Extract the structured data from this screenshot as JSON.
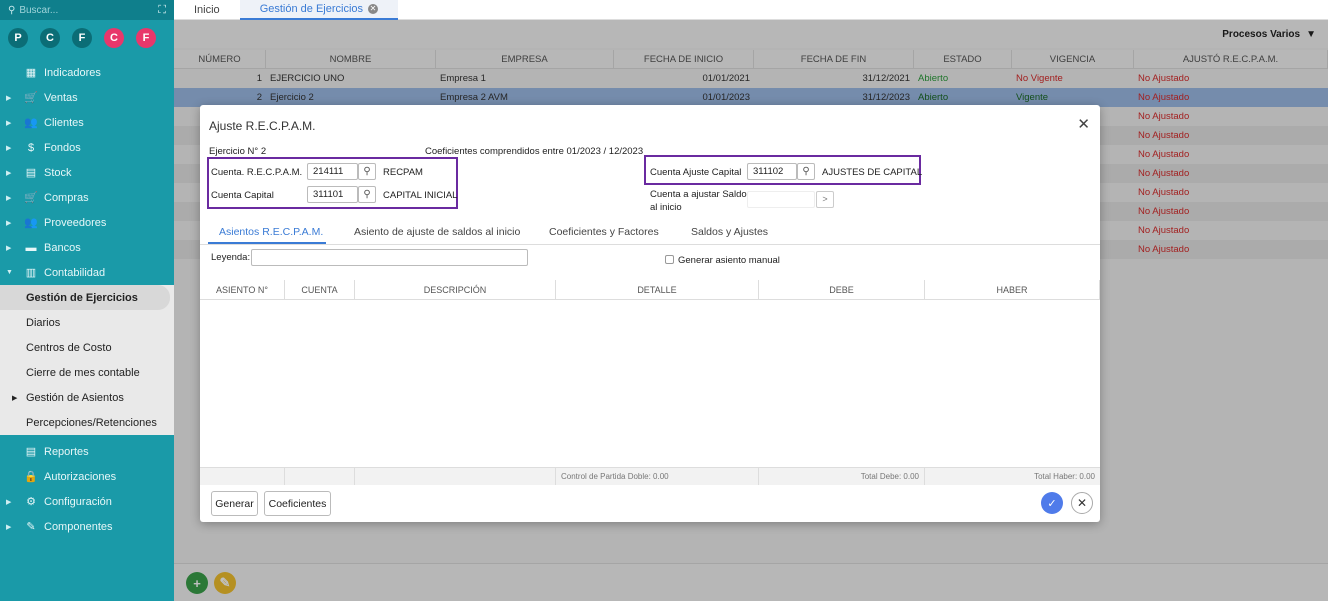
{
  "sidebar": {
    "search_placeholder": "Buscar...",
    "circles": [
      "P",
      "C",
      "F",
      "C",
      "F"
    ],
    "items": [
      {
        "label": "Indicadores",
        "icon": "grid-icon",
        "glyph": "▦",
        "arrow": ""
      },
      {
        "label": "Ventas",
        "icon": "cart-icon",
        "glyph": "🛒",
        "arrow": "▶"
      },
      {
        "label": "Clientes",
        "icon": "people-icon",
        "glyph": "👥",
        "arrow": "▶"
      },
      {
        "label": "Fondos",
        "icon": "dollar-icon",
        "glyph": "$",
        "arrow": "▶"
      },
      {
        "label": "Stock",
        "icon": "box-icon",
        "glyph": "▤",
        "arrow": "▶"
      },
      {
        "label": "Compras",
        "icon": "cart-icon",
        "glyph": "🛒",
        "arrow": "▶"
      },
      {
        "label": "Proveedores",
        "icon": "people-icon",
        "glyph": "👥",
        "arrow": "▶"
      },
      {
        "label": "Bancos",
        "icon": "bank-icon",
        "glyph": "▬",
        "arrow": "▶"
      },
      {
        "label": "Contabilidad",
        "icon": "book-icon",
        "glyph": "▥",
        "arrow": "▼"
      }
    ],
    "sub_items": [
      {
        "label": "Gestión de Ejercicios",
        "active": true
      },
      {
        "label": "Diarios"
      },
      {
        "label": "Centros de Costo"
      },
      {
        "label": "Cierre de mes contable"
      },
      {
        "label": "Gestión de Asientos",
        "arrow": "▶"
      },
      {
        "label": "Percepciones/Retenciones"
      }
    ],
    "items_after": [
      {
        "label": "Reportes",
        "icon": "report-icon",
        "glyph": "▤",
        "arrow": ""
      },
      {
        "label": "Autorizaciones",
        "icon": "lock-icon",
        "glyph": "🔒",
        "arrow": ""
      },
      {
        "label": "Configuración",
        "icon": "gear-icon",
        "glyph": "⚙",
        "arrow": "▶"
      },
      {
        "label": "Componentes",
        "icon": "puzzle-icon",
        "glyph": "✎",
        "arrow": "▶"
      }
    ]
  },
  "topbar": {
    "tab_home": "Inicio",
    "tab_active": "Gestión de Ejercicios"
  },
  "procesos": "Procesos Varios",
  "table": {
    "headers": [
      "NÚMERO",
      "NOMBRE",
      "EMPRESA",
      "FECHA DE INICIO",
      "FECHA DE FIN",
      "ESTADO",
      "VIGENCIA",
      "AJUSTÓ R.E.C.P.A.M."
    ],
    "rows": [
      {
        "num": "1",
        "nombre": "EJERCICIO UNO",
        "empresa": "Empresa 1",
        "inicio": "01/01/2021",
        "fin": "31/12/2021",
        "estado": "Abierto",
        "vigencia": "No Vigente",
        "ajusto": "No Ajustado",
        "vig_class": "red",
        "cls": ""
      },
      {
        "num": "2",
        "nombre": "Ejercicio 2",
        "empresa": "Empresa 2 AVM",
        "inicio": "01/01/2023",
        "fin": "31/12/2023",
        "estado": "Abierto",
        "vigencia": "Vigente",
        "ajusto": "No Ajustado",
        "vig_class": "green",
        "cls": "sel"
      },
      {
        "num": "",
        "nombre": "",
        "empresa": "",
        "inicio": "",
        "fin": "",
        "estado": "",
        "vigencia": "",
        "ajusto": "No Ajustado",
        "vig_class": "",
        "cls": ""
      },
      {
        "num": "",
        "nombre": "",
        "empresa": "",
        "inicio": "",
        "fin": "",
        "estado": "",
        "vigencia": "",
        "ajusto": "No Ajustado",
        "vig_class": "",
        "cls": "alt"
      },
      {
        "num": "",
        "nombre": "",
        "empresa": "",
        "inicio": "",
        "fin": "",
        "estado": "",
        "vigencia": "",
        "ajusto": "No Ajustado",
        "vig_class": "",
        "cls": ""
      },
      {
        "num": "",
        "nombre": "",
        "empresa": "",
        "inicio": "",
        "fin": "",
        "estado": "",
        "vigencia": "",
        "ajusto": "No Ajustado",
        "vig_class": "",
        "cls": "alt"
      },
      {
        "num": "",
        "nombre": "",
        "empresa": "",
        "inicio": "",
        "fin": "",
        "estado": "",
        "vigencia": "",
        "ajusto": "No Ajustado",
        "vig_class": "",
        "cls": ""
      },
      {
        "num": "",
        "nombre": "",
        "empresa": "",
        "inicio": "",
        "fin": "",
        "estado": "",
        "vigencia": "",
        "ajusto": "No Ajustado",
        "vig_class": "",
        "cls": "alt"
      },
      {
        "num": "",
        "nombre": "",
        "empresa": "",
        "inicio": "",
        "fin": "",
        "estado": "",
        "vigencia": "",
        "ajusto": "No Ajustado",
        "vig_class": "",
        "cls": ""
      },
      {
        "num": "",
        "nombre": "",
        "empresa": "",
        "inicio": "",
        "fin": "",
        "estado": "",
        "vigencia": "",
        "ajusto": "No Ajustado",
        "vig_class": "",
        "cls": "alt"
      }
    ]
  },
  "modal": {
    "title": "Ajuste R.E.C.P.A.M.",
    "ejercicio": "Ejercicio N° 2",
    "coeficientes": "Coeficientes comprendidos entre 01/2023 / 12/2023",
    "cuenta_recpam_label": "Cuenta. R.E.C.P.A.M.",
    "cuenta_recpam_code": "214111",
    "cuenta_recpam_name": "RECPAM",
    "cuenta_capital_label": "Cuenta Capital",
    "cuenta_capital_code": "311101",
    "cuenta_capital_name": "CAPITAL INICIAL",
    "cuenta_ajuste_label": "Cuenta Ajuste Capital",
    "cuenta_ajuste_code": "311102",
    "cuenta_ajuste_name": "AJUSTES DE CAPITAL",
    "cuenta_saldos_label_1": "Cuenta a ajustar Saldos",
    "cuenta_saldos_label_2": "al inicio",
    "tabs": [
      "Asientos R.E.C.P.A.M.",
      "Asiento de ajuste de saldos al inicio",
      "Coeficientes y Factores",
      "Saldos y Ajustes"
    ],
    "leyenda_label": "Leyenda:",
    "generar_manual": "Generar asiento manual",
    "grid_headers": [
      "ASIENTO N°",
      "CUENTA",
      "DESCRIPCIÓN",
      "DETALLE",
      "DEBE",
      "HABER"
    ],
    "control": "Control de Partida Doble: 0.00",
    "total_debe": "Total Debe: 0.00",
    "total_haber": "Total Haber: 0.00",
    "btn_generar": "Generar",
    "btn_coeficientes": "Coeficientes"
  }
}
